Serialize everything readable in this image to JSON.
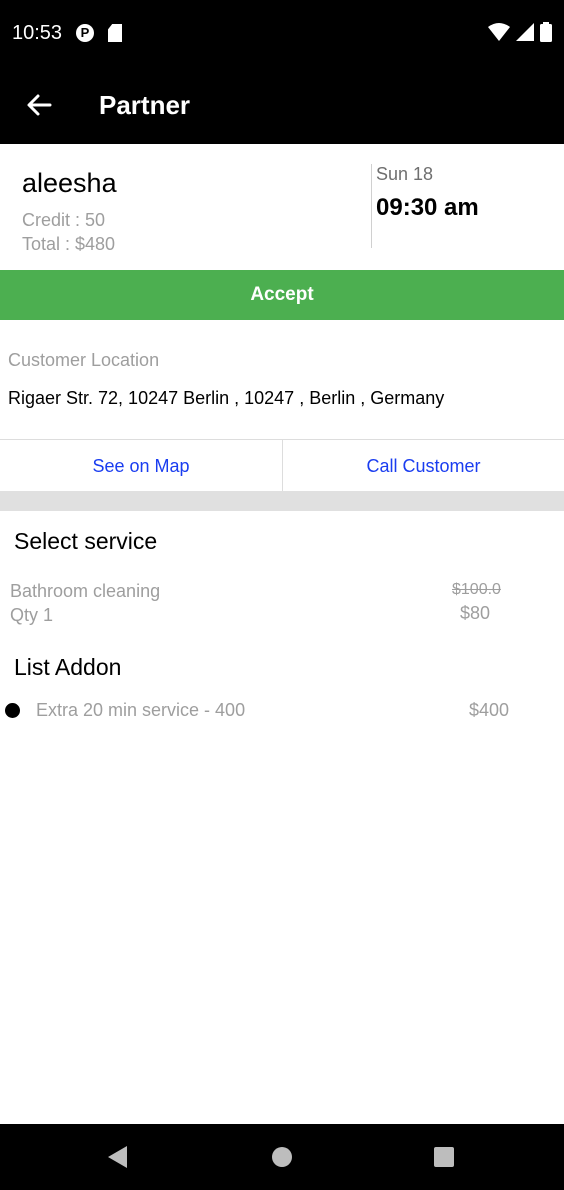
{
  "status_bar": {
    "time": "10:53"
  },
  "app_bar": {
    "title": "Partner"
  },
  "booking": {
    "customer_name": "aleesha",
    "credit": "Credit : 50",
    "total": "Total : $480",
    "day": "Sun 18",
    "time": "09:30 am"
  },
  "accept_label": "Accept",
  "location": {
    "label": "Customer Location",
    "address": "Rigaer Str. 72, 10247  Berlin , 10247 , Berlin , Germany"
  },
  "actions": {
    "map_label": "See on Map",
    "call_label": "Call Customer"
  },
  "services": {
    "title": "Select service",
    "items": [
      {
        "name": "Bathroom cleaning",
        "qty": "Qty 1",
        "original_price": "$100.0",
        "price": "$80"
      }
    ]
  },
  "addons": {
    "title": "List Addon",
    "items": [
      {
        "name": "Extra 20 min service - 400",
        "price": "$400"
      }
    ]
  },
  "colors": {
    "accept": "#4caf50",
    "link": "#1a3df0",
    "muted": "#9e9e9e"
  }
}
